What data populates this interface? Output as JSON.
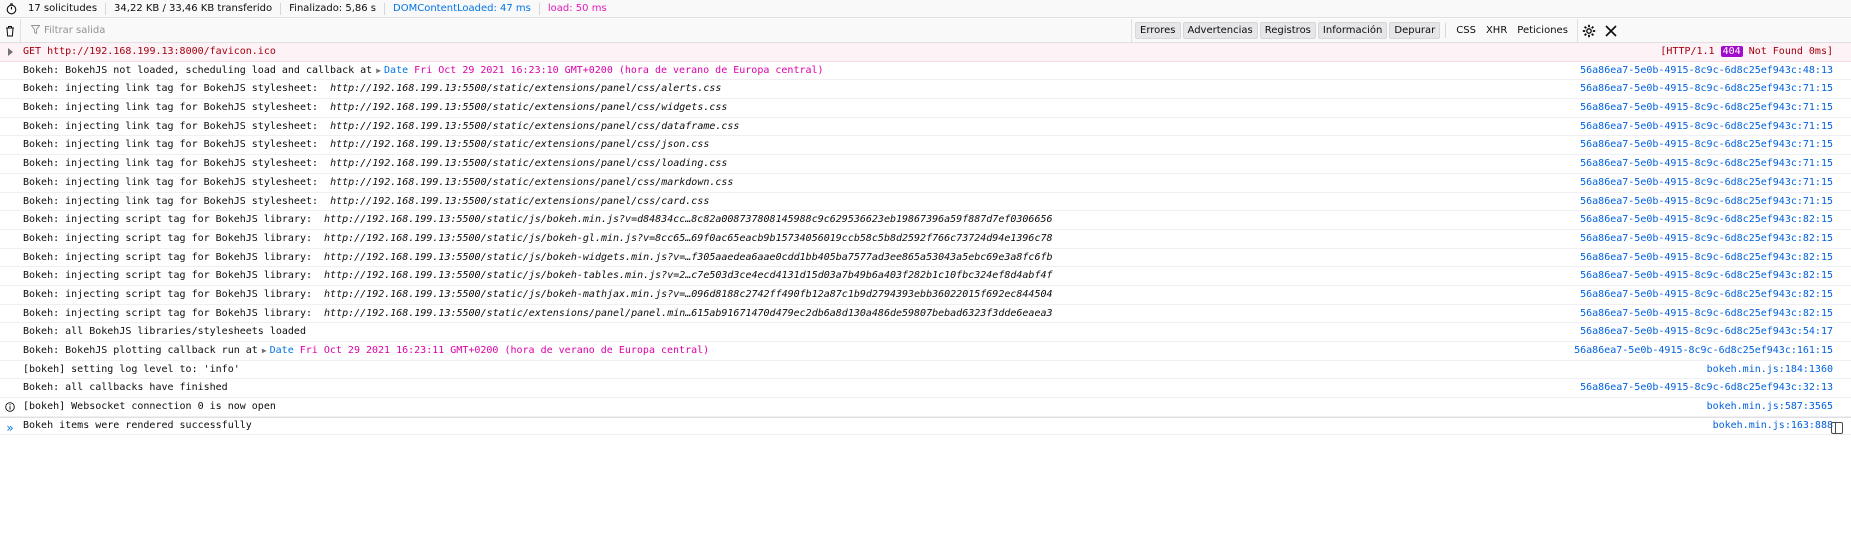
{
  "statusbar": {
    "requests": "17 solicitudes",
    "transferred": "34,22 KB / 33,46 KB transferido",
    "finished": "Finalizado: 5,86 s",
    "dom_loaded": "DOMContentLoaded: 47 ms",
    "load": "load: 50 ms"
  },
  "toolbar": {
    "filter_placeholder": "Filtrar salida",
    "filters": [
      "Errores",
      "Advertencias",
      "Registros",
      "Información",
      "Depurar"
    ],
    "extra": [
      "CSS",
      "XHR",
      "Peticiones"
    ]
  },
  "error_row": {
    "method": "GET",
    "url": "http://192.168.199.13:8000/favicon.ico",
    "status_prefix": "[HTTP/1.1",
    "status_code": "404",
    "status_suffix": "Not Found 0ms]"
  },
  "rows": [
    {
      "text": "Bokeh: BokehJS not loaded, scheduling load and callback at",
      "date_label": "Date",
      "date_value": "Fri Oct 29 2021 16:23:10 GMT+0200 (hora de verano de Europa central)",
      "url": "",
      "source": "56a86ea7-5e0b-4915-8c9c-6d8c25ef943c:48:13",
      "icon": ""
    },
    {
      "text": "Bokeh: injecting link tag for BokehJS stylesheet:",
      "date_label": "",
      "date_value": "",
      "url": "http://192.168.199.13:5500/static/extensions/panel/css/alerts.css",
      "source": "56a86ea7-5e0b-4915-8c9c-6d8c25ef943c:71:15",
      "icon": ""
    },
    {
      "text": "Bokeh: injecting link tag for BokehJS stylesheet:",
      "date_label": "",
      "date_value": "",
      "url": "http://192.168.199.13:5500/static/extensions/panel/css/widgets.css",
      "source": "56a86ea7-5e0b-4915-8c9c-6d8c25ef943c:71:15",
      "icon": ""
    },
    {
      "text": "Bokeh: injecting link tag for BokehJS stylesheet:",
      "date_label": "",
      "date_value": "",
      "url": "http://192.168.199.13:5500/static/extensions/panel/css/dataframe.css",
      "source": "56a86ea7-5e0b-4915-8c9c-6d8c25ef943c:71:15",
      "icon": ""
    },
    {
      "text": "Bokeh: injecting link tag for BokehJS stylesheet:",
      "date_label": "",
      "date_value": "",
      "url": "http://192.168.199.13:5500/static/extensions/panel/css/json.css",
      "source": "56a86ea7-5e0b-4915-8c9c-6d8c25ef943c:71:15",
      "icon": ""
    },
    {
      "text": "Bokeh: injecting link tag for BokehJS stylesheet:",
      "date_label": "",
      "date_value": "",
      "url": "http://192.168.199.13:5500/static/extensions/panel/css/loading.css",
      "source": "56a86ea7-5e0b-4915-8c9c-6d8c25ef943c:71:15",
      "icon": ""
    },
    {
      "text": "Bokeh: injecting link tag for BokehJS stylesheet:",
      "date_label": "",
      "date_value": "",
      "url": "http://192.168.199.13:5500/static/extensions/panel/css/markdown.css",
      "source": "56a86ea7-5e0b-4915-8c9c-6d8c25ef943c:71:15",
      "icon": ""
    },
    {
      "text": "Bokeh: injecting link tag for BokehJS stylesheet:",
      "date_label": "",
      "date_value": "",
      "url": "http://192.168.199.13:5500/static/extensions/panel/css/card.css",
      "source": "56a86ea7-5e0b-4915-8c9c-6d8c25ef943c:71:15",
      "icon": ""
    },
    {
      "text": "Bokeh: injecting script tag for BokehJS library:",
      "date_label": "",
      "date_value": "",
      "url": "http://192.168.199.13:5500/static/js/bokeh.min.js?v=d84834cc…8c82a008737808145988c9c629536623eb19867396a59f887d7ef0306656",
      "source": "56a86ea7-5e0b-4915-8c9c-6d8c25ef943c:82:15",
      "icon": ""
    },
    {
      "text": "Bokeh: injecting script tag for BokehJS library:",
      "date_label": "",
      "date_value": "",
      "url": "http://192.168.199.13:5500/static/js/bokeh-gl.min.js?v=8cc65…69f0ac65eacb9b15734056019ccb58c5b8d2592f766c73724d94e1396c78",
      "source": "56a86ea7-5e0b-4915-8c9c-6d8c25ef943c:82:15",
      "icon": ""
    },
    {
      "text": "Bokeh: injecting script tag for BokehJS library:",
      "date_label": "",
      "date_value": "",
      "url": "http://192.168.199.13:5500/static/js/bokeh-widgets.min.js?v=…f305aaedea6aae0cdd1bb405ba7577ad3ee865a53043a5ebc69e3a8fc6fb",
      "source": "56a86ea7-5e0b-4915-8c9c-6d8c25ef943c:82:15",
      "icon": ""
    },
    {
      "text": "Bokeh: injecting script tag for BokehJS library:",
      "date_label": "",
      "date_value": "",
      "url": "http://192.168.199.13:5500/static/js/bokeh-tables.min.js?v=2…c7e503d3ce4ecd4131d15d03a7b49b6a403f282b1c10fbc324ef8d4abf4f",
      "source": "56a86ea7-5e0b-4915-8c9c-6d8c25ef943c:82:15",
      "icon": ""
    },
    {
      "text": "Bokeh: injecting script tag for BokehJS library:",
      "date_label": "",
      "date_value": "",
      "url": "http://192.168.199.13:5500/static/js/bokeh-mathjax.min.js?v=…096d8188c2742ff490fb12a87c1b9d2794393ebb36022015f692ec844504",
      "source": "56a86ea7-5e0b-4915-8c9c-6d8c25ef943c:82:15",
      "icon": ""
    },
    {
      "text": "Bokeh: injecting script tag for BokehJS library:",
      "date_label": "",
      "date_value": "",
      "url": "http://192.168.199.13:5500/static/extensions/panel/panel.min…615ab91671470d479ec2db6a8d130a486de59807bebad6323f3dde6eaea3",
      "source": "56a86ea7-5e0b-4915-8c9c-6d8c25ef943c:82:15",
      "icon": ""
    },
    {
      "text": "Bokeh: all BokehJS libraries/stylesheets loaded",
      "date_label": "",
      "date_value": "",
      "url": "",
      "source": "56a86ea7-5e0b-4915-8c9c-6d8c25ef943c:54:17",
      "icon": ""
    },
    {
      "text": "Bokeh: BokehJS plotting callback run at",
      "date_label": "Date",
      "date_value": "Fri Oct 29 2021 16:23:11 GMT+0200 (hora de verano de Europa central)",
      "url": "",
      "source": "56a86ea7-5e0b-4915-8c9c-6d8c25ef943c:161:15",
      "icon": ""
    },
    {
      "text": "[bokeh] setting log level to: 'info'",
      "date_label": "",
      "date_value": "",
      "url": "",
      "source": "bokeh.min.js:184:1360",
      "icon": ""
    },
    {
      "text": "Bokeh: all callbacks have finished",
      "date_label": "",
      "date_value": "",
      "url": "",
      "source": "56a86ea7-5e0b-4915-8c9c-6d8c25ef943c:32:13",
      "icon": ""
    },
    {
      "text": "[bokeh] Websocket connection 0 is now open",
      "date_label": "",
      "date_value": "",
      "url": "",
      "source": "bokeh.min.js:587:3565",
      "icon": "info-icon"
    },
    {
      "text": "Bokeh items were rendered successfully",
      "date_label": "",
      "date_value": "",
      "url": "",
      "source": "bokeh.min.js:163:888",
      "icon": ""
    }
  ]
}
